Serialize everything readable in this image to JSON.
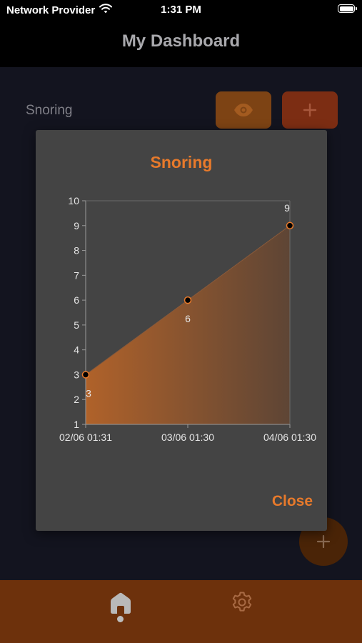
{
  "status_bar": {
    "carrier": "Network Provider",
    "time": "1:31 PM"
  },
  "header": {
    "title": "My Dashboard"
  },
  "main": {
    "metric_label": "Snoring"
  },
  "dialog": {
    "title": "Snoring",
    "close_label": "Close"
  },
  "colors": {
    "accent": "#e87a2b",
    "nav_background": "#6d310c",
    "dialog_background": "#444444"
  },
  "icons": {
    "view_button": "eye-icon",
    "add_button": "plus-icon",
    "fab": "plus-icon",
    "nav_home": "home-icon",
    "nav_settings": "gear-icon"
  },
  "chart_data": {
    "type": "area",
    "title": "Snoring",
    "categories": [
      "02/06 01:31",
      "03/06 01:30",
      "04/06 01:30"
    ],
    "values": [
      3,
      6,
      9
    ],
    "data_labels": [
      "3",
      "6",
      "9"
    ],
    "y_ticks": [
      "1",
      "2",
      "3",
      "4",
      "5",
      "6",
      "7",
      "8",
      "9",
      "10"
    ],
    "ylim": [
      1,
      10
    ],
    "grid": false,
    "legend": "none"
  }
}
